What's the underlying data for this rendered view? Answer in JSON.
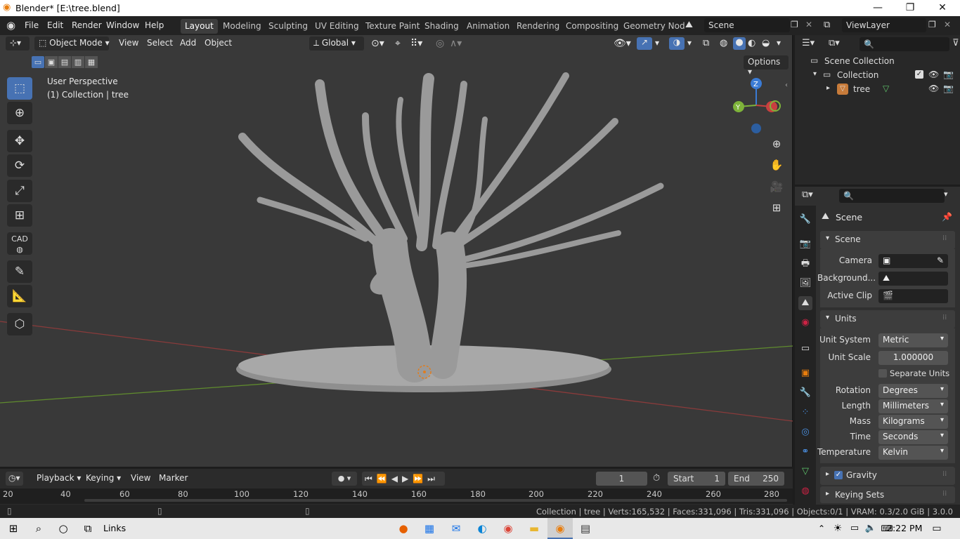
{
  "window": {
    "title": "Blender* [E:\\tree.blend]",
    "minimize": "—",
    "maximize": "❐",
    "close": "✕"
  },
  "menu": {
    "items": [
      "File",
      "Edit",
      "Render",
      "Window",
      "Help"
    ]
  },
  "workspaces": [
    "Layout",
    "Modeling",
    "Sculpting",
    "UV Editing",
    "Texture Paint",
    "Shading",
    "Animation",
    "Rendering",
    "Compositing",
    "Geometry Nod"
  ],
  "scene_field": "Scene",
  "viewlayer_field": "ViewLayer",
  "viewport_header": {
    "mode": "Object Mode",
    "view": "View",
    "select": "Select",
    "add": "Add",
    "object": "Object",
    "orientation": "Global",
    "options": "Options"
  },
  "viewport_info": {
    "perspective": "User Perspective",
    "collection": "(1) Collection | tree"
  },
  "tools": {
    "cad": "CAD"
  },
  "gizmo": {
    "x": "X",
    "y": "Y",
    "z": "Z"
  },
  "outliner": {
    "scene_collection": "Scene Collection",
    "collection": "Collection",
    "object": "tree"
  },
  "properties": {
    "context": "Scene",
    "scene_panel": "Scene",
    "camera_label": "Camera",
    "background_label": "Background...",
    "active_clip_label": "Active Clip",
    "units_panel": "Units",
    "unit_system_label": "Unit System",
    "unit_system": "Metric",
    "unit_scale_label": "Unit Scale",
    "unit_scale": "1.000000",
    "separate_units": "Separate Units",
    "rotation_label": "Rotation",
    "rotation": "Degrees",
    "length_label": "Length",
    "length": "Millimeters",
    "mass_label": "Mass",
    "mass": "Kilograms",
    "time_label": "Time",
    "time": "Seconds",
    "temperature_label": "Temperature",
    "temperature": "Kelvin",
    "gravity_panel": "Gravity",
    "keying_sets_panel": "Keying Sets"
  },
  "timeline": {
    "playback": "Playback",
    "keying": "Keying",
    "view": "View",
    "marker": "Marker",
    "current_frame": "1",
    "start_label": "Start",
    "start": "1",
    "end_label": "End",
    "end": "250",
    "ruler": [
      "20",
      "40",
      "60",
      "80",
      "100",
      "120",
      "140",
      "160",
      "180",
      "200",
      "220",
      "240",
      "260",
      "280"
    ]
  },
  "status_bar": "Collection | tree | Verts:165,532 | Faces:331,096 | Tris:331,096 | Objects:0/1 | VRAM: 0.3/2.0 GiB | 3.0.0",
  "taskbar": {
    "links": "Links",
    "time": "2:22 PM"
  },
  "colors": {
    "accent": "#4772b3",
    "x_axis": "#c8403f",
    "y_axis": "#7eb33a",
    "z_axis": "#3a7bd5",
    "viewport_bg": "#393939"
  }
}
